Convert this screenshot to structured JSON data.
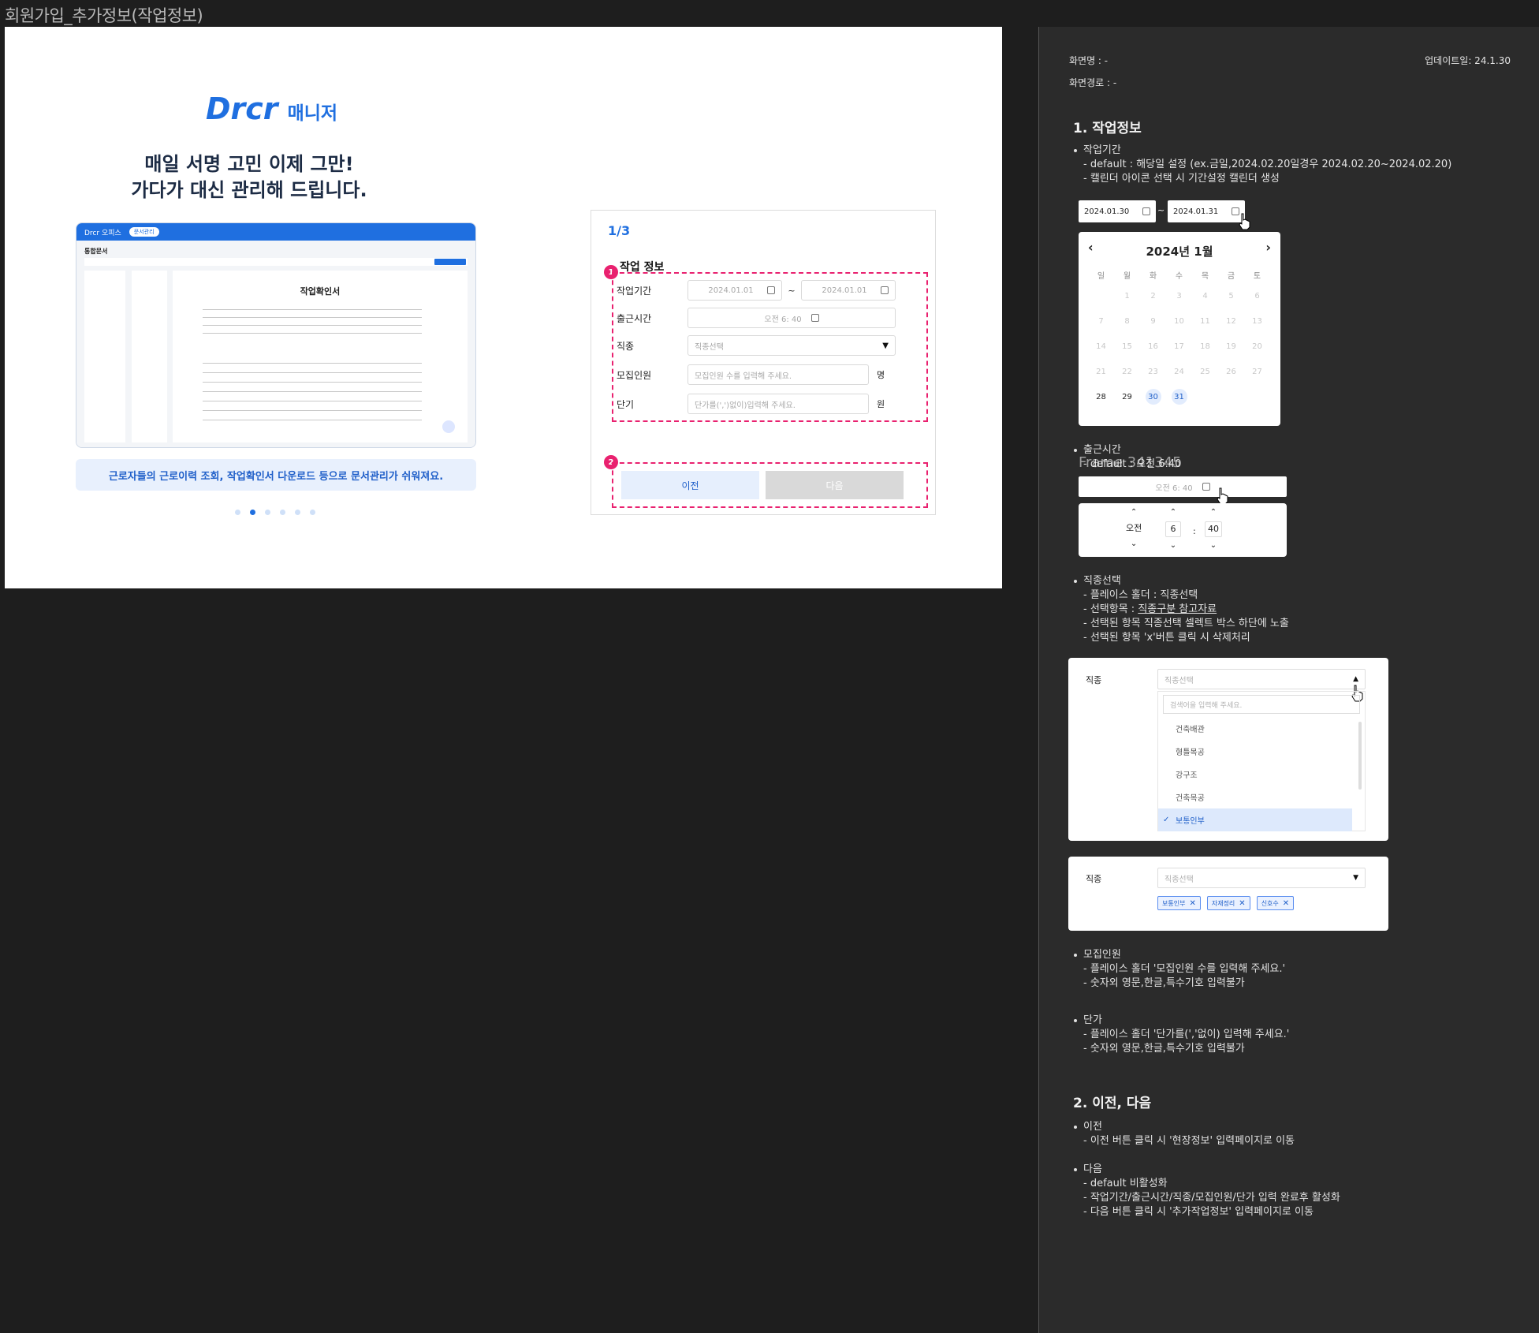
{
  "frame_title": "회원가입_추가정보(작업정보)",
  "landing": {
    "brand": "Drcr",
    "brand_suffix": "매니저",
    "headline_1": "매일 서명 고민 이제 그만!",
    "headline_2": "가다가 대신 관리해 드립니다.",
    "preview": {
      "app": "Drcr 오피스",
      "menu_pill": "문서관리",
      "section": "통합문서",
      "doc_title": "작업확인서"
    },
    "caption": "근로자들의 근로이력 조회, 작업확인서 다운로드 등으로 문서관리가 쉬워져요.",
    "slide_index": 2,
    "slide_count": 6
  },
  "form": {
    "step": "1/3",
    "section_title": "작업 정보",
    "badge_1": "1",
    "badge_2": "2",
    "period_label": "작업기간",
    "period_start": "2024.01.01",
    "period_sep": "~",
    "period_end": "2024.01.01",
    "start_time_label": "출근시간",
    "start_time": "오전 6: 40",
    "job_label": "직종",
    "job_placeholder": "직종선택",
    "recruit_label": "모집인원",
    "recruit_placeholder": "모집인원 수를 입력해 주세요.",
    "recruit_unit": "명",
    "price_label": "단기",
    "price_placeholder": "단가를(',')없이)입력해 주세요.",
    "price_unit": "원",
    "prev_button": "이전",
    "next_button": "다음"
  },
  "spec": {
    "screen_name": "화면명 : -",
    "screen_path": "화면경로 : -",
    "updated": "업데이트일: 24.1.30",
    "h1": "1. 작업정보",
    "period": {
      "title": "작업기간",
      "l1": "- default : 해당일 설정 (ex.금일,2024.02.20일경우 2024.02.20~2024.02.20)",
      "l2": "- 캘린더 아이콘 선택 시 기간설정 캘린더 생성",
      "date_from": "2024.01.30",
      "date_sep": "~",
      "date_to": "2024.01.31"
    },
    "calendar": {
      "month": "2024년 1월",
      "weekdays": [
        "일",
        "월",
        "화",
        "수",
        "목",
        "금",
        "토"
      ],
      "weeks": [
        [
          "",
          "1",
          "2",
          "3",
          "4",
          "5",
          "6"
        ],
        [
          "7",
          "8",
          "9",
          "10",
          "11",
          "12",
          "13"
        ],
        [
          "14",
          "15",
          "16",
          "17",
          "18",
          "19",
          "20"
        ],
        [
          "21",
          "22",
          "23",
          "24",
          "25",
          "26",
          "27"
        ],
        [
          "28",
          "29",
          "30",
          "31",
          "",
          "",
          ""
        ]
      ]
    },
    "start_time": {
      "title": "출근시간",
      "l1": "- default : 오전 6:40",
      "overlay": "Frame 341345",
      "value": "오전 6: 40",
      "ampm": "오전",
      "hour": "6",
      "colon": ":",
      "minute": "40"
    },
    "job": {
      "title": "직종선택",
      "l1": "- 플레이스 홀더 : 직종선택",
      "l2a": "- 선택항목 : ",
      "l2b": "직종구분 참고자료",
      "l3": "- 선택된 항목 직종선택 셀렉트 박스 하단에 노출",
      "l4": "- 선택된 항목 'x'버튼 클릭 시 삭제처리",
      "label": "직종",
      "placeholder": "직종선택",
      "search_placeholder": "검색어을 입력해 주세요.",
      "options": [
        "건축배관",
        "형틀목공",
        "강구조",
        "건축목공",
        "보통인부"
      ],
      "selected_option": "보통인부",
      "chips": [
        "보통인부",
        "자재정리",
        "신호수"
      ]
    },
    "recruit": {
      "title": "모집인원",
      "l1": "- 플레이스 홀더 '모집인원 수를 입력해 주세요.'",
      "l2": "- 숫자외 영문,한글,특수기호 입력불가"
    },
    "price": {
      "title": "단가",
      "l1": "- 플레이스 홀더 '단가를(','없이) 입력해 주세요.'",
      "l2": "- 숫자외 영문,한글,특수기호 입력불가"
    },
    "h2": "2. 이전, 다음",
    "prev": {
      "title": "이전",
      "l1": "- 이전 버튼 클릭 시 '현장정보' 입력페이지로 이동"
    },
    "next": {
      "title": "다음",
      "l1": "- default 비활성화",
      "l2": "- 작업기간/출근시간/직종/모집인원/단가 입력 완료후 활성화",
      "l3": "- 다음 버튼 클릭 시 '추가작업정보' 입력페이지로 이동"
    }
  }
}
